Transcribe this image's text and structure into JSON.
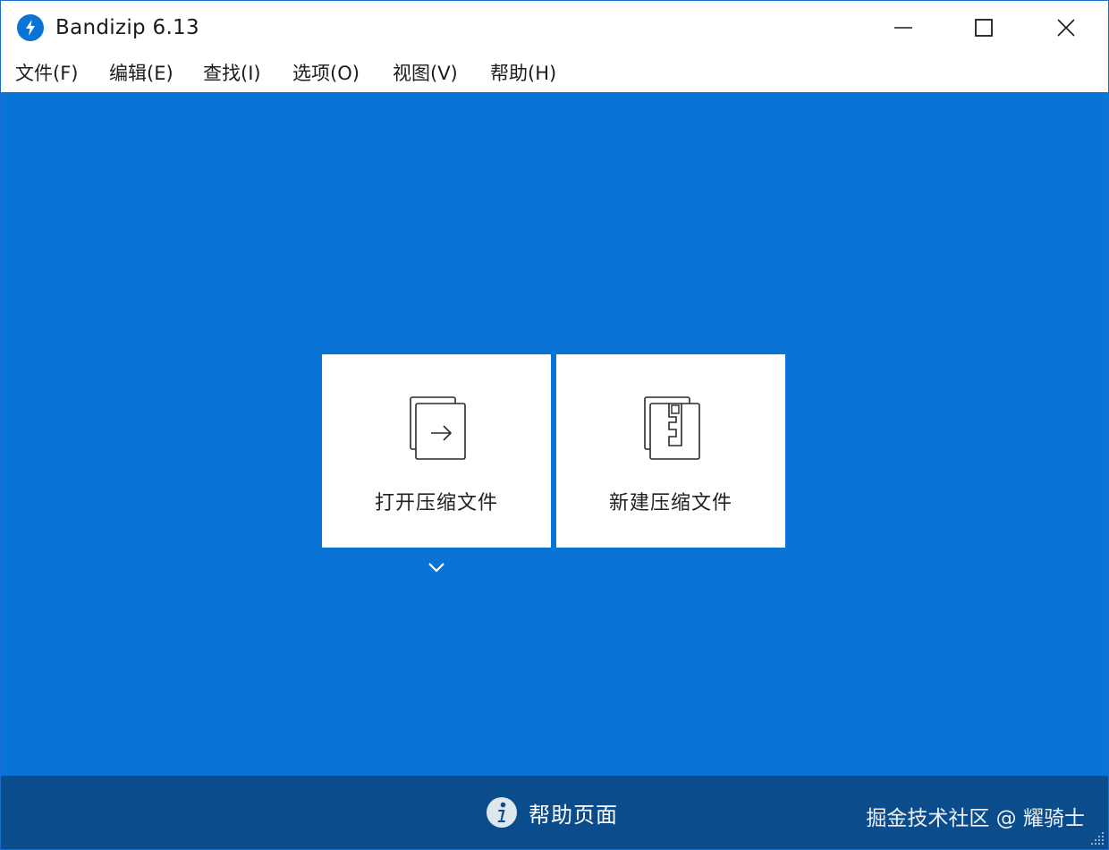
{
  "window": {
    "title": "Bandizip 6.13",
    "accent_color": "#0a73d6",
    "footer_color": "#0b4d8c"
  },
  "titlebar": {
    "icon": "bandizip-logo-icon",
    "controls": [
      "minimize-icon",
      "maximize-icon",
      "close-icon"
    ]
  },
  "menu": {
    "items": [
      {
        "label": "文件(F)"
      },
      {
        "label": "编辑(E)"
      },
      {
        "label": "查找(I)"
      },
      {
        "label": "选项(O)"
      },
      {
        "label": "视图(V)"
      },
      {
        "label": "帮助(H)"
      }
    ]
  },
  "main": {
    "tiles": [
      {
        "label": "打开压缩文件",
        "icon": "open-archive-icon"
      },
      {
        "label": "新建压缩文件",
        "icon": "new-archive-icon"
      }
    ],
    "expand_icon": "chevron-down-icon"
  },
  "footer": {
    "help_label": "帮助页面",
    "help_icon": "info-icon",
    "watermark": "掘金技术社区 @ 耀骑士"
  }
}
